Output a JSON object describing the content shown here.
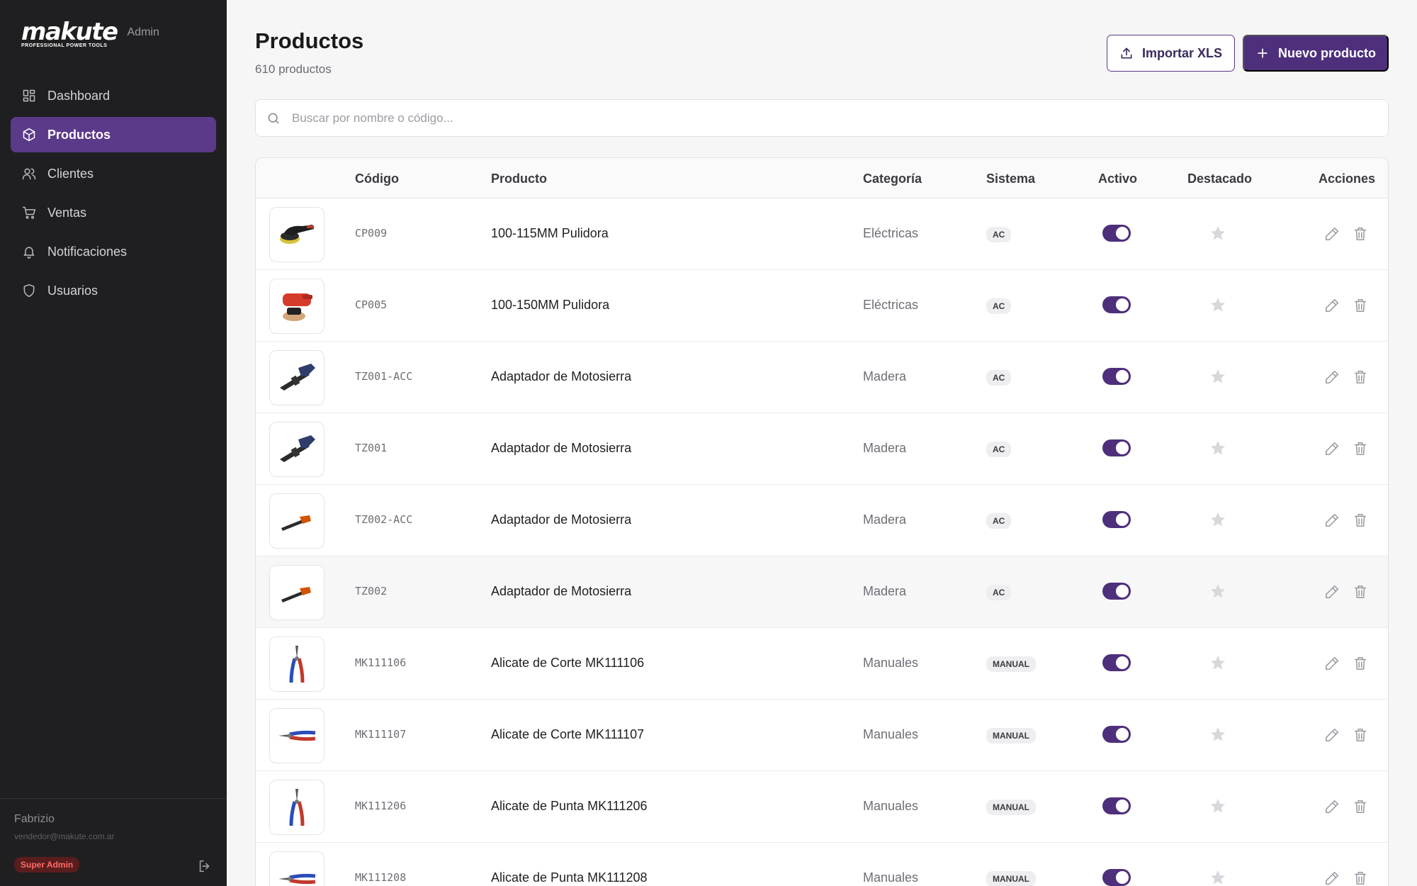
{
  "brand": {
    "logo": "makute",
    "tagline": "PROFESSIONAL POWER TOOLS",
    "section": "Admin"
  },
  "nav": [
    {
      "label": "Dashboard",
      "icon": "dashboard-icon",
      "active": false
    },
    {
      "label": "Productos",
      "icon": "box-icon",
      "active": true
    },
    {
      "label": "Clientes",
      "icon": "users-icon",
      "active": false
    },
    {
      "label": "Ventas",
      "icon": "cart-icon",
      "active": false
    },
    {
      "label": "Notificaciones",
      "icon": "bell-icon",
      "active": false
    },
    {
      "label": "Usuarios",
      "icon": "shield-icon",
      "active": false
    }
  ],
  "user": {
    "name": "Fabrizio",
    "email": "vendedor@makute.com.ar",
    "role": "Super Admin"
  },
  "header": {
    "title": "Productos",
    "count": "610 productos",
    "import_label": "Importar XLS",
    "new_label": "Nuevo producto"
  },
  "search": {
    "placeholder": "Buscar por nombre o código..."
  },
  "table": {
    "headers": {
      "code": "Código",
      "product": "Producto",
      "category": "Categoría",
      "system": "Sistema",
      "active": "Activo",
      "featured": "Destacado",
      "actions": "Acciones"
    },
    "rows": [
      {
        "code": "CP009",
        "product": "100-115MM Pulidora",
        "category": "Eléctricas",
        "system": "AC",
        "active": true,
        "featured": false,
        "thumb": "polisher-black"
      },
      {
        "code": "CP005",
        "product": "100-150MM Pulidora",
        "category": "Eléctricas",
        "system": "AC",
        "active": true,
        "featured": false,
        "thumb": "polisher-red"
      },
      {
        "code": "TZ001-ACC",
        "product": "Adaptador de Motosierra",
        "category": "Madera",
        "system": "AC",
        "active": true,
        "featured": false,
        "thumb": "chainsaw-blue"
      },
      {
        "code": "TZ001",
        "product": "Adaptador de Motosierra",
        "category": "Madera",
        "system": "AC",
        "active": true,
        "featured": false,
        "thumb": "chainsaw-blue"
      },
      {
        "code": "TZ002-ACC",
        "product": "Adaptador de Motosierra",
        "category": "Madera",
        "system": "AC",
        "active": true,
        "featured": false,
        "thumb": "chainsaw-small"
      },
      {
        "code": "TZ002",
        "product": "Adaptador de Motosierra",
        "category": "Madera",
        "system": "AC",
        "active": true,
        "featured": false,
        "thumb": "chainsaw-small"
      },
      {
        "code": "MK111106",
        "product": "Alicate de Corte MK111106",
        "category": "Manuales",
        "system": "MANUAL",
        "active": true,
        "featured": false,
        "thumb": "pliers-vertical"
      },
      {
        "code": "MK111107",
        "product": "Alicate de Corte MK111107",
        "category": "Manuales",
        "system": "MANUAL",
        "active": true,
        "featured": false,
        "thumb": "pliers-horizontal"
      },
      {
        "code": "MK111206",
        "product": "Alicate de Punta MK111206",
        "category": "Manuales",
        "system": "MANUAL",
        "active": true,
        "featured": false,
        "thumb": "pliers-vertical"
      },
      {
        "code": "MK111208",
        "product": "Alicate de Punta MK111208",
        "category": "Manuales",
        "system": "MANUAL",
        "active": true,
        "featured": false,
        "thumb": "pliers-horizontal"
      }
    ]
  },
  "colors": {
    "accent": "#4e2f7c",
    "sidebar": "#1f1f21",
    "role_badge": "#ff6b6b"
  }
}
